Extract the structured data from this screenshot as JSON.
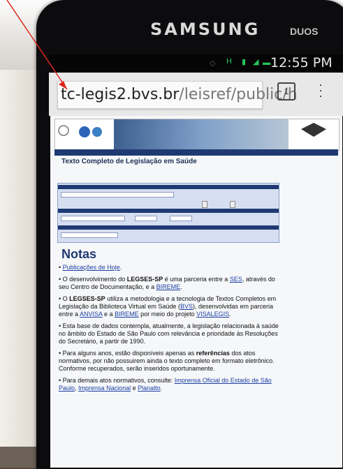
{
  "device": {
    "brand": "SAMSUNG",
    "badge": "DUOS"
  },
  "status_bar": {
    "time": "12:55 PM"
  },
  "browser": {
    "url_host": "tc-legis2.bvs.br",
    "url_path": "/leisref/public/h",
    "tab_count": "1"
  },
  "page": {
    "heading": "Texto Completo de Legislação em Saúde",
    "notas_title": "Notas",
    "notes": {
      "item1_link": "Publicações de Hoje",
      "item2_a": "O desenvolvimento do ",
      "item2_b": "LEGSES-SP",
      "item2_c": " é uma parceria entre a ",
      "item2_link1": "SES",
      "item2_d": ", através do seu Centro de Documentação, e a ",
      "item2_link2": "BIREME",
      "item3_a": "O ",
      "item3_b": "LEGSES-SP",
      "item3_c": " utiliza a metodologia e a tecnologia de Textos Completos em Legislação da Biblioteca Virtual em Saúde (",
      "item3_link1": "BVS",
      "item3_d": "), desenvolvidas em parceria entre a ",
      "item3_link2": "ANVISA",
      "item3_e": " e a ",
      "item3_link3": "BIREME",
      "item3_f": " por meio do projeto ",
      "item3_link4": "VISALEGIS",
      "item4": "Esta base de dados contempla, atualmente, a legislação relacionada à saúde no âmbito do Estado de São Paulo com relevância e prioridade às Resoluções do Secretário, a partir de 1990.",
      "item5_a": "Para alguns anos, estão disponíveis apenas as ",
      "item5_b": "referências",
      "item5_c": " dos atos normativos, por não possuirem ainda o texto completo em formato eletrônico. Conforme recuperados, serão inseridos oportunamente.",
      "item6_a": "Para demais atos normativos, consulte: ",
      "item6_link1": "Imprensa Oficial do Estado de São Paulo",
      "item6_link2": "Imprensa Nacional",
      "item6_e": " e ",
      "item6_link3": "Planalto"
    }
  },
  "colors": {
    "annotation_arrow": "#e0261f",
    "link": "#1a3fa3",
    "navy": "#1f3a72"
  }
}
